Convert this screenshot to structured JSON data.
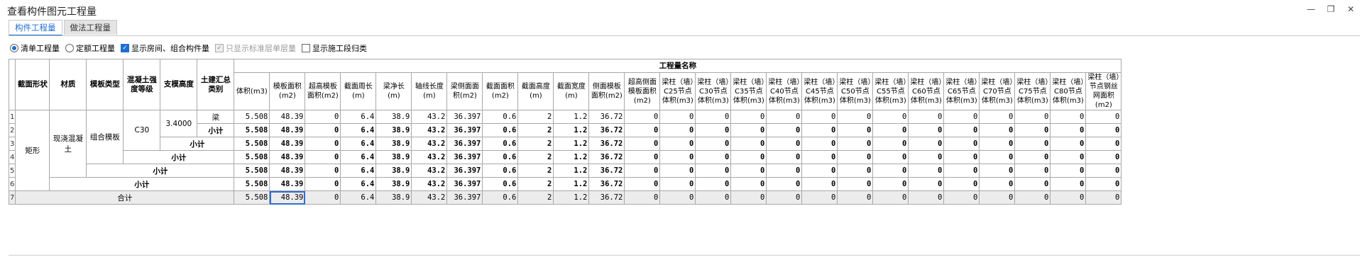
{
  "window": {
    "title": "查看构件图元工程量",
    "minimize": "—",
    "restore": "❐",
    "close": "✕"
  },
  "tabs": [
    "构件工程量",
    "做法工程量"
  ],
  "options": {
    "list_qty": "清单工程量",
    "quota_qty": "定额工程量",
    "show_room": "显示房间、组合构件量",
    "std_floor_only": "只显示标准层单层量",
    "show_segment": "显示施工段归类"
  },
  "headers": {
    "section_shape": "截面形状",
    "material": "材质",
    "formwork_type": "模板类型",
    "concrete_grade": "混凝土强度等级",
    "support_height": "支模高度",
    "civil_category": "土建汇总类别",
    "group": "工程量名称",
    "cols": [
      "体积(m3)",
      "模板面积(m2)",
      "超高模板面积(m2)",
      "截面周长(m)",
      "梁净长(m)",
      "轴线长度(m)",
      "梁侧面面积(m2)",
      "截面面积(m2)",
      "截面高度(m)",
      "截面宽度(m)",
      "侧面模板面积(m2)",
      "超高侧面模板面积(m2)",
      "梁柱（墙）C25节点体积(m3)",
      "梁柱（墙）C30节点体积(m3)",
      "梁柱（墙）C35节点体积(m3)",
      "梁柱（墙）C40节点体积(m3)",
      "梁柱（墙）C45节点体积(m3)",
      "梁柱（墙）C50节点体积(m3)",
      "梁柱（墙）C55节点体积(m3)",
      "梁柱（墙）C60节点体积(m3)",
      "梁柱（墙）C65节点体积(m3)",
      "梁柱（墙）C70节点体积(m3)",
      "梁柱（墙）C75节点体积(m3)",
      "梁柱（墙）C80节点体积(m3)",
      "梁柱（墙）节点钢丝网面积(m2)"
    ]
  },
  "labels": {
    "shape": "矩形",
    "material": "现浇混凝土",
    "formwork": "组合模板",
    "grade": "C30",
    "height": "3.4000",
    "category": "梁",
    "subtotal": "小计",
    "total": "合计"
  },
  "row_numbers": [
    "1",
    "2",
    "3",
    "4",
    "5",
    "6",
    "7"
  ],
  "values": [
    "5.508",
    "48.39",
    "0",
    "6.4",
    "38.9",
    "43.2",
    "36.397",
    "0.6",
    "2",
    "1.2",
    "36.72",
    "0",
    "0",
    "0",
    "0",
    "0",
    "0",
    "0",
    "0",
    "0",
    "0",
    "0",
    "0",
    "0",
    "0"
  ]
}
